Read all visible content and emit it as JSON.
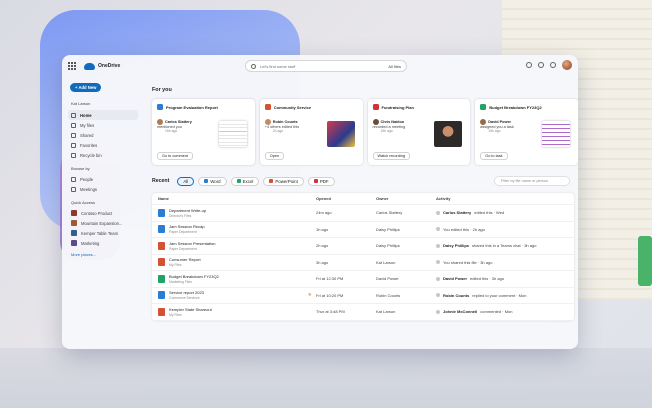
{
  "colors": {
    "accent": "#0f6cbd",
    "word": "#2b7cd3",
    "excel": "#21a366",
    "powerpoint": "#d35230",
    "pdf": "#e0e0e0",
    "loop": "#7b5bd8",
    "star": "#e8a33a"
  },
  "app": {
    "name": "OneDrive"
  },
  "search": {
    "placeholder": "Let's find some stuff",
    "filter_label": "All files"
  },
  "sidebar": {
    "add_new": "+ Add New",
    "user": "Kat Larson",
    "items": [
      {
        "label": "Home",
        "icon": "home-icon",
        "active": true
      },
      {
        "label": "My files",
        "icon": "folder-icon"
      },
      {
        "label": "Shared",
        "icon": "people-icon"
      },
      {
        "label": "Favorites",
        "icon": "star-icon"
      },
      {
        "label": "Recycle bin",
        "icon": "trash-icon"
      }
    ],
    "browse_title": "Browse by",
    "browse": [
      {
        "label": "People",
        "icon": "person-icon"
      },
      {
        "label": "Meetings",
        "icon": "calendar-icon"
      }
    ],
    "quick_title": "Quick Access",
    "quick": [
      {
        "label": "Contoso Product",
        "color": "#8a3a2f"
      },
      {
        "label": "Mountain Expansion...",
        "color": "#a05c2f"
      },
      {
        "label": "Kemper Table Team",
        "color": "#2f5f8a"
      },
      {
        "label": "Marketing",
        "color": "#5b4a8a"
      }
    ],
    "more_places": "More places..."
  },
  "foryou": {
    "title": "For you",
    "cards": [
      {
        "title": "Program Evaluation Report",
        "app_color": "#2b7cd3",
        "person": "Carlos Slattery",
        "action": "mentioned you",
        "time": "15h ago",
        "button": "Go to comment",
        "thumb": "t-doc",
        "face": "#b07a55"
      },
      {
        "title": "Community Service",
        "app_color": "#d35230",
        "person": "Robin Counts",
        "action": "+4 others edited this",
        "time": "2h ago",
        "button": "Open",
        "thumb": "t-game",
        "face": "#c48a60"
      },
      {
        "title": "Fundraising Plan",
        "app_color": "#d13438",
        "person": "Chris Naidoo",
        "action": "recorded a meeting",
        "time": "15h ago",
        "button": "Watch recording",
        "thumb": "t-meet",
        "face": "#6f4a36"
      },
      {
        "title": "Budget Breakdown FY23Q2",
        "app_color": "#21a366",
        "person": "David Power",
        "action": "assigned you a task",
        "time": "15h ago",
        "button": "Go to task",
        "thumb": "t-sheet",
        "face": "#9a6b4a"
      }
    ]
  },
  "recent": {
    "title": "Recent",
    "filters": [
      {
        "label": "All",
        "selected": true,
        "color": ""
      },
      {
        "label": "Word",
        "color": "#2b7cd3"
      },
      {
        "label": "Excel",
        "color": "#21a366"
      },
      {
        "label": "PowerPoint",
        "color": "#d35230"
      },
      {
        "label": "PDF",
        "color": "#d13438"
      }
    ],
    "filter_placeholder": "Filter by file name or person",
    "columns": [
      "Name",
      "Opened",
      "Owner",
      "Activity"
    ],
    "rows": [
      {
        "name": "Department Write-up",
        "location": "Director's Files",
        "opened": "24m ago",
        "owner": "Carlos Slattery",
        "activity_person": "Carlos Slattery",
        "activity": "edited this · Wed",
        "color": "#2b7cd3",
        "star": false
      },
      {
        "name": "Jam Session Recap",
        "location": "Paper Department",
        "opened": "1h ago",
        "owner": "Daisy Phillips",
        "activity_person": "",
        "activity": "You edited this · 2h ago",
        "color": "#2b7cd3",
        "star": false
      },
      {
        "name": "Jam Session Presentation",
        "location": "Paper Department",
        "opened": "2h ago",
        "owner": "Daisy Phillips",
        "activity_person": "Daisy Phillips",
        "activity": "shared this in a Teams chat · 3h ago",
        "color": "#d35230",
        "star": false
      },
      {
        "name": "Consumer Report",
        "location": "My Files",
        "opened": "3h ago",
        "owner": "Kat Larson",
        "activity_person": "",
        "activity": "You shared this file · 3h ago",
        "color": "#d35230",
        "star": false
      },
      {
        "name": "Budget Breakdown FY23Q2",
        "location": "Marketing Files",
        "opened": "Fri at 12:30 PM",
        "owner": "David Power",
        "activity_person": "David Power",
        "activity": "edited this · 3h ago",
        "color": "#21a366",
        "star": false
      },
      {
        "name": "Service report 2023",
        "location": "Commerce Services",
        "opened": "Fri at 10:20 PM",
        "owner": "Robin Counts",
        "activity_person": "Robin Counts",
        "activity": "replied to your comment · Mon",
        "color": "#2b7cd3",
        "star": true
      },
      {
        "name": "Kempler State Shareout",
        "location": "My Files",
        "opened": "Thur at 3:48 PM",
        "owner": "Kat Larson",
        "activity_person": "Johnie McConnell",
        "activity": "commented · Mon",
        "color": "#d35230",
        "star": false
      }
    ]
  }
}
